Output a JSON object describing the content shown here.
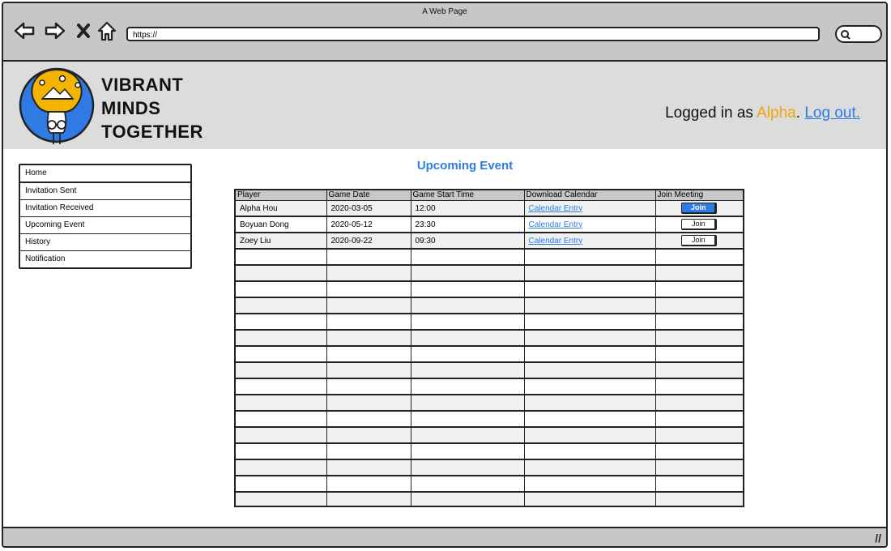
{
  "window": {
    "title": "A Web Page"
  },
  "browser": {
    "url": "https://"
  },
  "brand": {
    "line1": "VIBRANT",
    "line2": "MINDS",
    "line3": "TOGETHER"
  },
  "login": {
    "prefix": "Logged in as ",
    "user": "Alpha",
    "separator": ". ",
    "logout": "Log out."
  },
  "sidebar": {
    "items": [
      {
        "label": "Home"
      },
      {
        "label": "Invitation Sent"
      },
      {
        "label": "Invitation Received"
      },
      {
        "label": "Upcoming Event"
      },
      {
        "label": "History"
      },
      {
        "label": "Notification"
      }
    ]
  },
  "main": {
    "title": "Upcoming Event",
    "columns": [
      "Player",
      "Game Date",
      "Game Start Time",
      "Download Calendar",
      "Join Meeting"
    ],
    "rows": [
      {
        "player": "Alpha Hou",
        "date": "2020-03-05",
        "time": "12:00",
        "calendar": "Calendar Entry",
        "join": "Join"
      },
      {
        "player": "Boyuan Dong",
        "date": "2020-05-12",
        "time": "23:30",
        "calendar": "Calendar Entry",
        "join": "Join"
      },
      {
        "player": "Zoey Liu",
        "date": "2020-09-22",
        "time": "09:30",
        "calendar": "Calendar Entry",
        "join": "Join"
      }
    ]
  },
  "colors": {
    "accent": "#2f7be3",
    "user": "#f4a20a",
    "header_bg": "#dcdcdc",
    "chrome_bg": "#c7c7c7"
  }
}
